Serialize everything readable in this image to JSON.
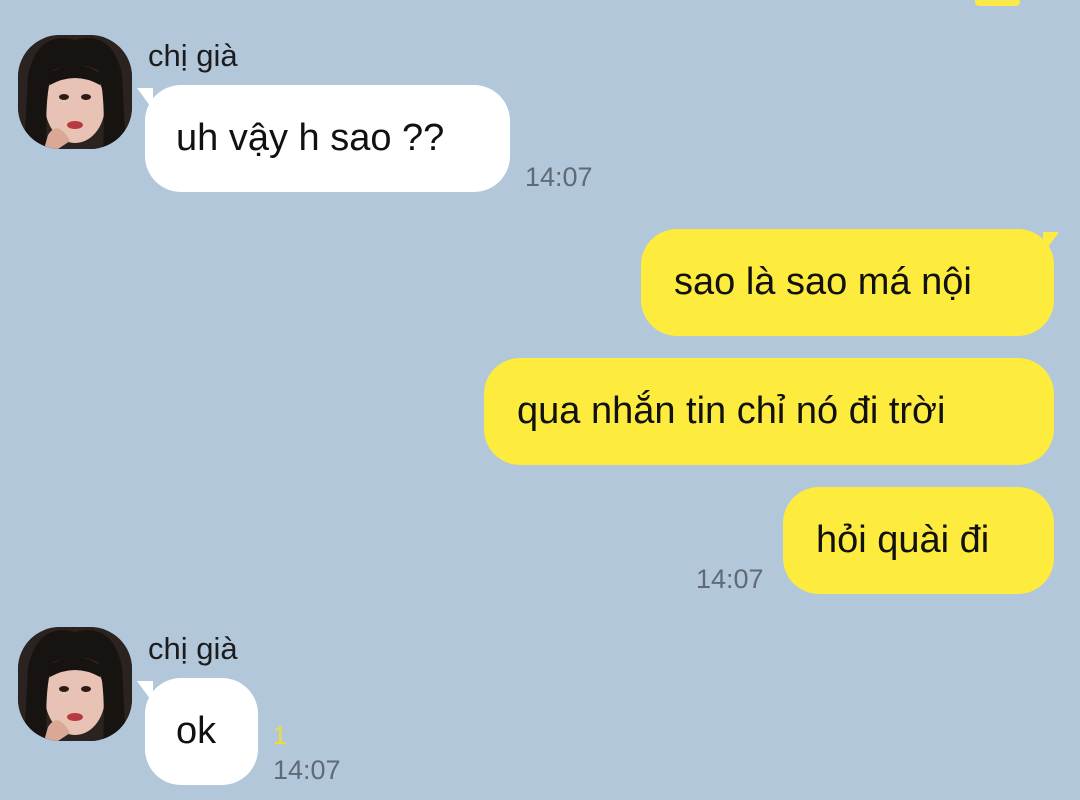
{
  "theme": {
    "background": "#b2c7da",
    "incoming_bubble": "#ffffff",
    "outgoing_bubble": "#fdeb3d",
    "unread_color": "#f3dd2c"
  },
  "messages": [
    {
      "direction": "incoming",
      "sender": "chị già",
      "avatar_icon": "profile-photo",
      "text": "uh vậy h sao ??",
      "time": "14:07"
    },
    {
      "direction": "outgoing",
      "text": "sao là sao má nội"
    },
    {
      "direction": "outgoing",
      "text": "qua nhắn tin chỉ nó đi trời"
    },
    {
      "direction": "outgoing",
      "text": "hỏi quài đi",
      "time": "14:07"
    },
    {
      "direction": "incoming",
      "sender": "chị già",
      "avatar_icon": "profile-photo",
      "text": "ok",
      "unread": "1",
      "time": "14:07"
    }
  ]
}
